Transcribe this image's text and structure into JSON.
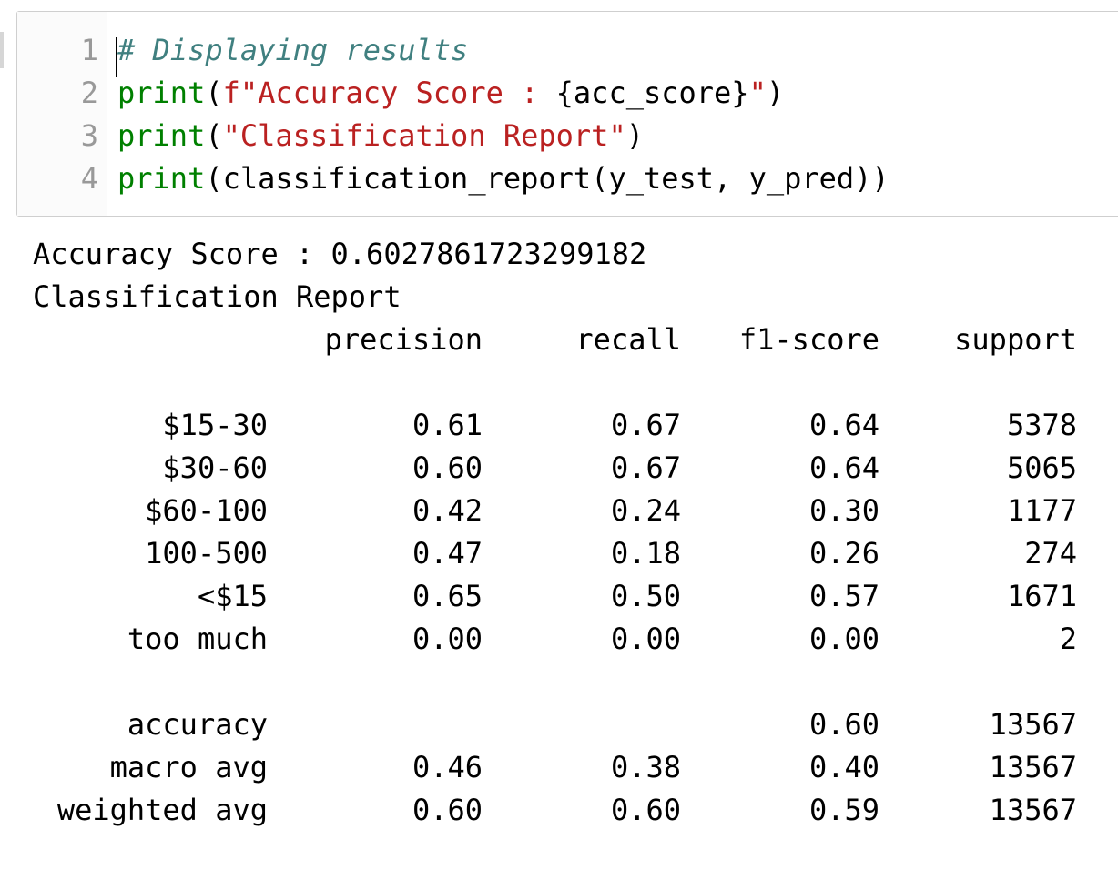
{
  "cell": {
    "line_numbers": [
      "1",
      "2",
      "3",
      "4"
    ],
    "lines": [
      [
        {
          "cls": "comment",
          "text": "# Displaying results"
        }
      ],
      [
        {
          "cls": "builtin",
          "text": "print"
        },
        {
          "cls": "",
          "text": "("
        },
        {
          "cls": "string",
          "text": "f\"Accuracy Score : "
        },
        {
          "cls": "interp",
          "text": "{acc_score}"
        },
        {
          "cls": "string",
          "text": "\""
        },
        {
          "cls": "",
          "text": ")"
        }
      ],
      [
        {
          "cls": "builtin",
          "text": "print"
        },
        {
          "cls": "",
          "text": "("
        },
        {
          "cls": "string",
          "text": "\"Classification Report\""
        },
        {
          "cls": "",
          "text": ")"
        }
      ],
      [
        {
          "cls": "builtin",
          "text": "print"
        },
        {
          "cls": "",
          "text": "(classification_report(y_test, y_pred))"
        }
      ]
    ]
  },
  "output": {
    "accuracy_line": "Accuracy Score : 0.6027861723299182",
    "report_title": "Classification Report",
    "header": {
      "label": "",
      "precision": "precision",
      "recall": "recall",
      "f1": "f1-score",
      "support": "support"
    },
    "class_rows": [
      {
        "label": "$15-30",
        "precision": "0.61",
        "recall": "0.67",
        "f1": "0.64",
        "support": "5378"
      },
      {
        "label": "$30-60",
        "precision": "0.60",
        "recall": "0.67",
        "f1": "0.64",
        "support": "5065"
      },
      {
        "label": "$60-100",
        "precision": "0.42",
        "recall": "0.24",
        "f1": "0.30",
        "support": "1177"
      },
      {
        "label": "100-500",
        "precision": "0.47",
        "recall": "0.18",
        "f1": "0.26",
        "support": "274"
      },
      {
        "label": "<$15",
        "precision": "0.65",
        "recall": "0.50",
        "f1": "0.57",
        "support": "1671"
      },
      {
        "label": "too much",
        "precision": "0.00",
        "recall": "0.00",
        "f1": "0.00",
        "support": "2"
      }
    ],
    "summary_rows": [
      {
        "label": "accuracy",
        "precision": "",
        "recall": "",
        "f1": "0.60",
        "support": "13567"
      },
      {
        "label": "macro avg",
        "precision": "0.46",
        "recall": "0.38",
        "f1": "0.40",
        "support": "13567"
      },
      {
        "label": "weighted avg",
        "precision": "0.60",
        "recall": "0.60",
        "f1": "0.59",
        "support": "13567"
      }
    ]
  }
}
